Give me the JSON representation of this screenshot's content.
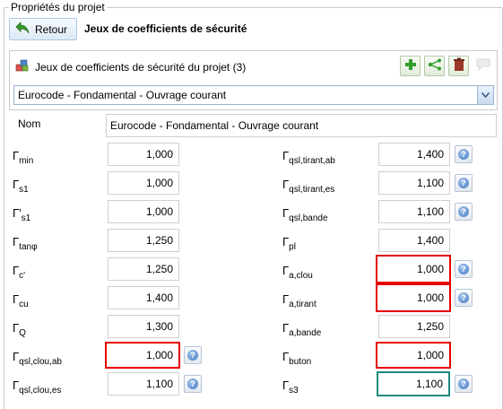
{
  "group_title": "Propriétés du projet",
  "toolbar": {
    "back_label": "Retour",
    "title": "Jeux de coefficients de sécurité"
  },
  "panel": {
    "header_label": "Jeux de coefficients de sécurité du projet (3)",
    "selected_set": "Eurocode - Fondamental - Ouvrage courant",
    "tools": [
      "add-icon",
      "share-icon",
      "delete-icon",
      "comment-icon"
    ]
  },
  "nom": {
    "label": "Nom",
    "value": "Eurocode - Fondamental - Ouvrage courant"
  },
  "left": [
    {
      "sym": "Γ",
      "sub": "min",
      "value": "1,000"
    },
    {
      "sym": "Γ",
      "sub": "s1",
      "value": "1,000"
    },
    {
      "sym": "Γ'",
      "sub": "s1",
      "value": "1,000"
    },
    {
      "sym": "Γ",
      "sub": "tanφ",
      "value": "1,250"
    },
    {
      "sym": "Γ",
      "sub": "c'",
      "value": "1,250"
    },
    {
      "sym": "Γ",
      "sub": "cu",
      "value": "1,400"
    },
    {
      "sym": "Γ",
      "sub": "Q",
      "value": "1,300"
    },
    {
      "sym": "Γ",
      "sub": "qsl,clou,ab",
      "value": "1,000"
    },
    {
      "sym": "Γ",
      "sub": "qsl,clou,es",
      "value": "1,100"
    }
  ],
  "right": [
    {
      "sym": "Γ",
      "sub": "qsl,tirant,ab",
      "value": "1,400"
    },
    {
      "sym": "Γ",
      "sub": "qsl,tirant,es",
      "value": "1,100"
    },
    {
      "sym": "Γ",
      "sub": "qsl,bande",
      "value": "1,100"
    },
    {
      "sym": "Γ",
      "sub": "pl",
      "value": "1,400"
    },
    {
      "sym": "Γ",
      "sub": "a,clou",
      "value": "1,000"
    },
    {
      "sym": "Γ",
      "sub": "a,tirant",
      "value": "1,000"
    },
    {
      "sym": "Γ",
      "sub": "a,bande",
      "value": "1,250"
    },
    {
      "sym": "Γ",
      "sub": "buton",
      "value": "1,000"
    },
    {
      "sym": "Γ",
      "sub": "s3",
      "value": "1,100"
    }
  ],
  "colors": {
    "highlight_red": "#e60000",
    "highlight_teal": "#1b8a7c",
    "accent_blue": "#3d74c0"
  }
}
